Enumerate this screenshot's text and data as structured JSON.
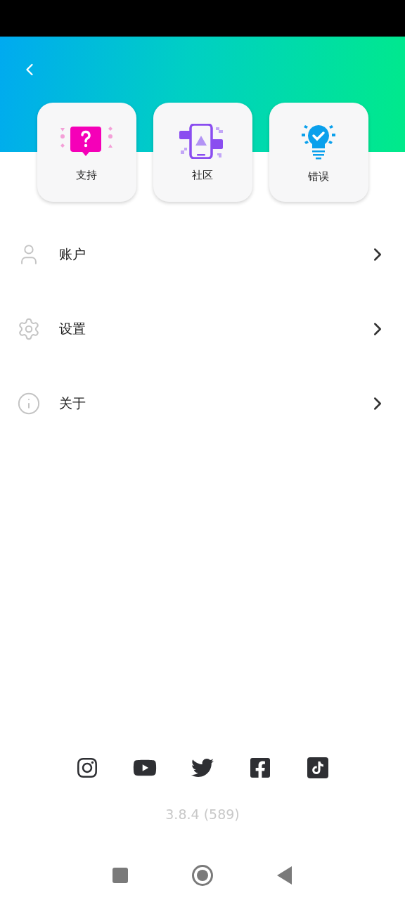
{
  "shortcuts": [
    {
      "kind": "support",
      "label": "支持"
    },
    {
      "kind": "community",
      "label": "社区"
    },
    {
      "kind": "bugs",
      "label": "错误"
    }
  ],
  "menu": [
    {
      "kind": "account",
      "label": "账户"
    },
    {
      "kind": "settings",
      "label": "设置"
    },
    {
      "kind": "about",
      "label": "关于"
    }
  ],
  "social": [
    {
      "kind": "instagram"
    },
    {
      "kind": "youtube"
    },
    {
      "kind": "twitter"
    },
    {
      "kind": "facebook"
    },
    {
      "kind": "tiktok"
    }
  ],
  "version": "3.8.4 (589)"
}
